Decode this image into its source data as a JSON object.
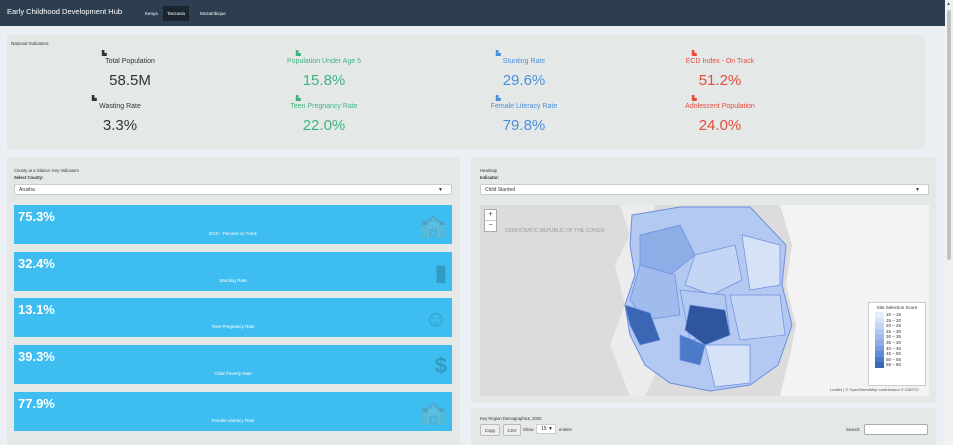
{
  "header": {
    "brand": "Early Childhood Development Hub",
    "tabs": [
      "Kenya",
      "Tanzania",
      "Mozambique"
    ]
  },
  "national": {
    "label": "National Indicators:",
    "indicators": [
      {
        "label": "Total Population",
        "value": "58.5M",
        "icon": "chart-icon",
        "color": "#333333"
      },
      {
        "label": "Population Under Age 5",
        "value": "15.8%",
        "icon": "chart-icon",
        "color": "#3fb37f"
      },
      {
        "label": "Stunting Rate",
        "value": "29.6%",
        "icon": "chart-icon",
        "color": "#4a90d9"
      },
      {
        "label": "ECD Index - On Track",
        "value": "51.2%",
        "icon": "chart-icon",
        "color": "#e74c3c"
      },
      {
        "label": "Wasting Rate",
        "value": "3.3%",
        "icon": "chart-icon",
        "color": "#333333"
      },
      {
        "label": "Teen Pregnancy Rate",
        "value": "22.0%",
        "icon": "chart-icon",
        "color": "#3fb37f"
      },
      {
        "label": "Female Literacy Rate",
        "value": "79.8%",
        "icon": "chart-icon",
        "color": "#4a90d9"
      },
      {
        "label": "Adolescent Population",
        "value": "24.0%",
        "icon": "chart-icon",
        "color": "#e74c3c"
      }
    ]
  },
  "county": {
    "title": "County at a Glance: Key Indicators",
    "select_label": "Select County:",
    "selected": "Arusha",
    "boxes": [
      {
        "value": "75.3%",
        "label": "ECD - Percent on Track",
        "icon": "school-icon"
      },
      {
        "value": "32.4%",
        "label": "Stunting Rate",
        "icon": "ruler-icon"
      },
      {
        "value": "13.1%",
        "label": "Teen Pregnancy Rate",
        "icon": "baby-icon"
      },
      {
        "value": "39.3%",
        "label": "Child Poverty Rate",
        "icon": "dollar-icon"
      },
      {
        "value": "77.9%",
        "label": "Female Literacy Rate",
        "icon": "school-icon"
      }
    ]
  },
  "heatmap": {
    "title": "Heatmap",
    "indicator_label": "Indicator:",
    "selected": "Child Stunted",
    "zoom_in": "+",
    "zoom_out": "−",
    "map_label": "DEMOCRATIC REPUBLIC OF THE CONGO",
    "legend_title": "Site Selection Score",
    "legend": [
      {
        "range": "10 – 15",
        "color": "#e6eefb"
      },
      {
        "range": "15 – 20",
        "color": "#d6e2f8"
      },
      {
        "range": "20 – 25",
        "color": "#c5d6f5"
      },
      {
        "range": "25 – 30",
        "color": "#b3c9f1"
      },
      {
        "range": "30 – 35",
        "color": "#a0bbec"
      },
      {
        "range": "35 – 40",
        "color": "#8cade6"
      },
      {
        "range": "40 – 45",
        "color": "#779dde"
      },
      {
        "range": "45 – 50",
        "color": "#618cd4"
      },
      {
        "range": "50 – 55",
        "color": "#4b7ac8"
      },
      {
        "range": "55 – 60",
        "color": "#3a66b3"
      }
    ],
    "attribution": "Leaflet | © OpenStreetMap contributors © CARTO"
  },
  "demographics": {
    "title": "Key Region Demographics, 2020",
    "copy": "Copy",
    "csv": "CSV",
    "show": "Show",
    "entries_value": "15",
    "entries": "entries",
    "search": "Search:"
  }
}
